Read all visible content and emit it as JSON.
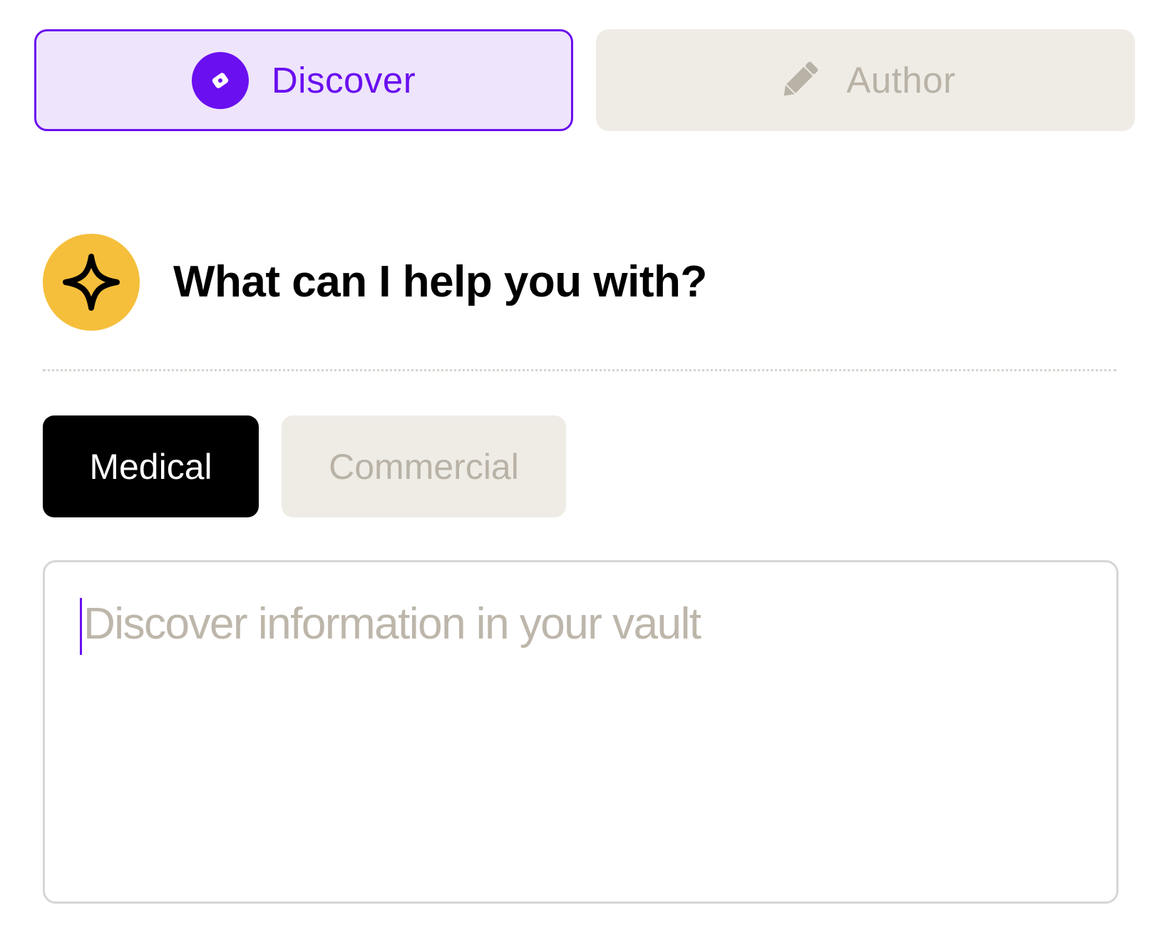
{
  "mode_tabs": {
    "discover": {
      "label": "Discover",
      "icon": "compass-icon",
      "active": true
    },
    "author": {
      "label": "Author",
      "icon": "pencil-icon",
      "active": false
    }
  },
  "assistant": {
    "icon": "sparkle-icon",
    "heading": "What can I help you with?"
  },
  "categories": {
    "medical": {
      "label": "Medical",
      "selected": true
    },
    "commercial": {
      "label": "Commercial",
      "selected": false
    }
  },
  "prompt": {
    "value": "",
    "placeholder": "Discover information in your vault"
  },
  "colors": {
    "accent": "#6a0ff0",
    "accent_bg": "#eee4fb",
    "neutral_bg": "#efece6",
    "muted_text": "#b9b2a6",
    "avatar_yellow": "#f5bf3b"
  }
}
